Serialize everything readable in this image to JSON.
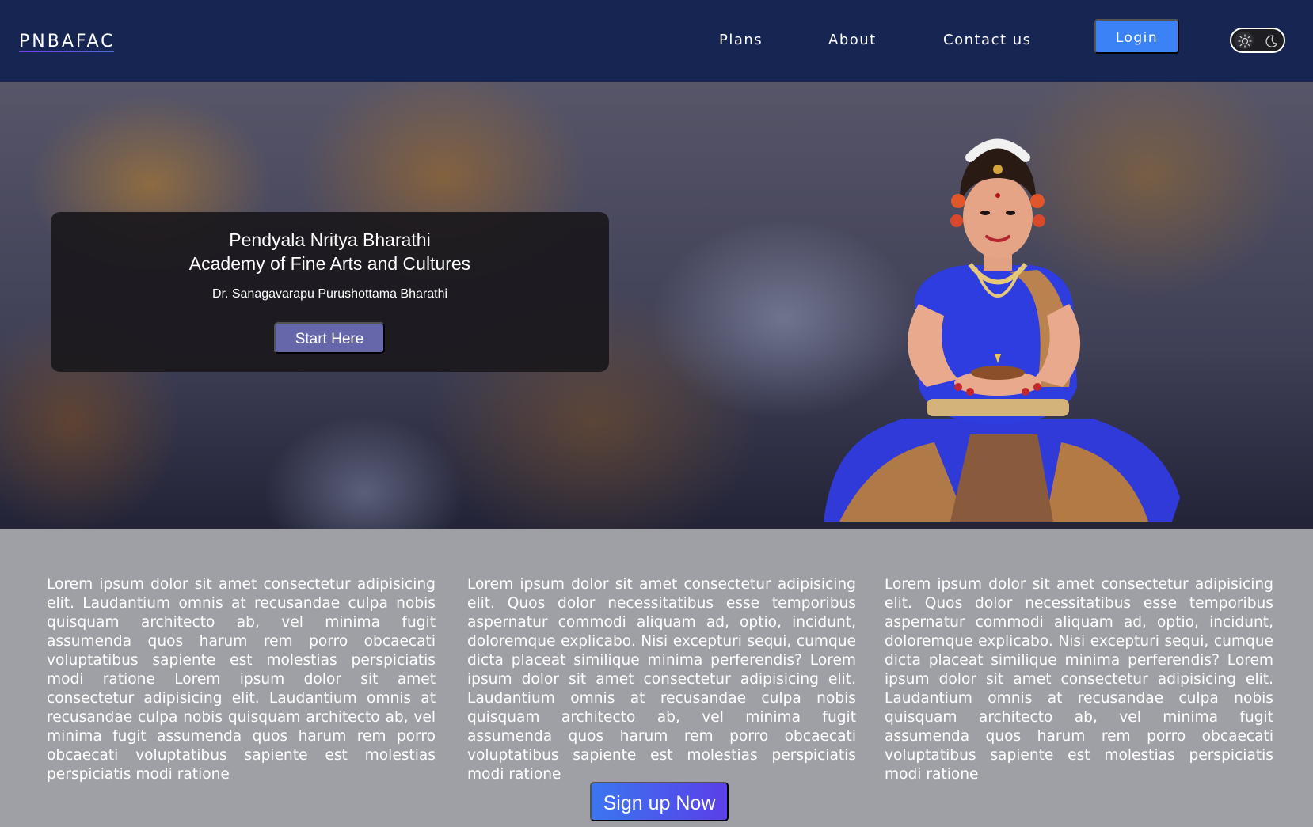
{
  "header": {
    "brand": "PNBAFAC",
    "nav": {
      "plans": "Plans",
      "about": "About",
      "contact": "Contact us"
    },
    "login_label": "Login",
    "theme_toggle": {
      "icons": [
        "sun-icon",
        "moon-icon"
      ],
      "mode": "dark"
    }
  },
  "hero": {
    "title_line1": "Pendyala Nritya Bharathi",
    "title_line2": "Academy of Fine Arts and Cultures",
    "subtitle": "Dr. Sanagavarapu Purushottama Bharathi",
    "cta_label": "Start Here"
  },
  "info": {
    "columns": [
      "Lorem ipsum dolor sit amet consectetur adipisicing elit. Laudantium omnis at recusandae culpa nobis quisquam architecto ab, vel minima fugit assumenda quos harum rem porro obcaecati voluptatibus sapiente est molestias perspiciatis modi ratione Lorem ipsum dolor sit amet consectetur adipisicing elit. Laudantium omnis at recusandae culpa nobis quisquam architecto ab, vel minima fugit assumenda quos harum rem porro obcaecati voluptatibus sapiente est molestias perspiciatis modi ratione",
      "Lorem ipsum dolor sit amet consectetur adipisicing elit. Quos dolor necessitatibus esse temporibus aspernatur commodi aliquam ad, optio, incidunt, doloremque explicabo. Nisi excepturi sequi, cumque dicta placeat similique minima perferendis? Lorem ipsum dolor sit amet consectetur adipisicing elit. Laudantium omnis at recusandae culpa nobis quisquam architecto ab, vel minima fugit assumenda quos harum rem porro obcaecati voluptatibus sapiente est molestias perspiciatis modi ratione",
      "Lorem ipsum dolor sit amet consectetur adipisicing elit. Quos dolor necessitatibus esse temporibus aspernatur commodi aliquam ad, optio, incidunt, doloremque explicabo. Nisi excepturi sequi, cumque dicta placeat similique minima perferendis? Lorem ipsum dolor sit amet consectetur adipisicing elit. Laudantium omnis at recusandae culpa nobis quisquam architecto ab, vel minima fugit assumenda quos harum rem porro obcaecati voluptatibus sapiente est molestias perspiciatis modi ratione"
    ],
    "signup_label": "Sign up Now"
  },
  "colors": {
    "navbar": "#172552",
    "login_button": "#3b82f6",
    "start_button": "#6667aa",
    "signup_gradient_start": "#3b76f0",
    "signup_gradient_end": "#5a3fe8",
    "info_background": "#9fa0a5"
  }
}
